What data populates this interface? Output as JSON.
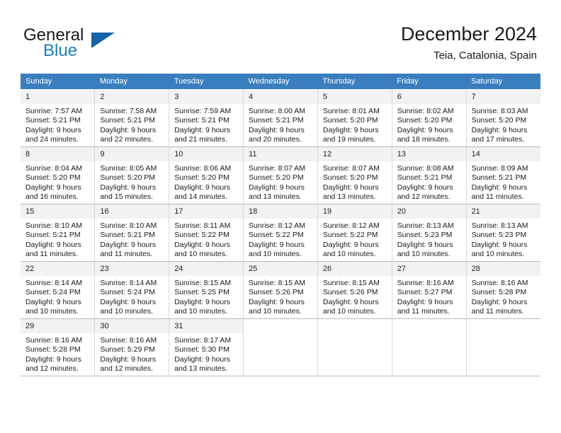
{
  "brand": {
    "word_general": "General",
    "word_blue": "Blue",
    "logo_icon": "triangle-flag-icon"
  },
  "header": {
    "title": "December 2024",
    "subtitle": "Teia, Catalonia, Spain"
  },
  "colors": {
    "header_row_bg": "#3a7ebf",
    "daynum_bg": "#f2f2f2",
    "brand_blue": "#1a7fc1",
    "grid_line": "#d9d9d9"
  },
  "weekdays": [
    "Sunday",
    "Monday",
    "Tuesday",
    "Wednesday",
    "Thursday",
    "Friday",
    "Saturday"
  ],
  "weeks": [
    [
      {
        "day": "1",
        "sunrise": "Sunrise: 7:57 AM",
        "sunset": "Sunset: 5:21 PM",
        "daylight1": "Daylight: 9 hours",
        "daylight2": "and 24 minutes."
      },
      {
        "day": "2",
        "sunrise": "Sunrise: 7:58 AM",
        "sunset": "Sunset: 5:21 PM",
        "daylight1": "Daylight: 9 hours",
        "daylight2": "and 22 minutes."
      },
      {
        "day": "3",
        "sunrise": "Sunrise: 7:59 AM",
        "sunset": "Sunset: 5:21 PM",
        "daylight1": "Daylight: 9 hours",
        "daylight2": "and 21 minutes."
      },
      {
        "day": "4",
        "sunrise": "Sunrise: 8:00 AM",
        "sunset": "Sunset: 5:21 PM",
        "daylight1": "Daylight: 9 hours",
        "daylight2": "and 20 minutes."
      },
      {
        "day": "5",
        "sunrise": "Sunrise: 8:01 AM",
        "sunset": "Sunset: 5:20 PM",
        "daylight1": "Daylight: 9 hours",
        "daylight2": "and 19 minutes."
      },
      {
        "day": "6",
        "sunrise": "Sunrise: 8:02 AM",
        "sunset": "Sunset: 5:20 PM",
        "daylight1": "Daylight: 9 hours",
        "daylight2": "and 18 minutes."
      },
      {
        "day": "7",
        "sunrise": "Sunrise: 8:03 AM",
        "sunset": "Sunset: 5:20 PM",
        "daylight1": "Daylight: 9 hours",
        "daylight2": "and 17 minutes."
      }
    ],
    [
      {
        "day": "8",
        "sunrise": "Sunrise: 8:04 AM",
        "sunset": "Sunset: 5:20 PM",
        "daylight1": "Daylight: 9 hours",
        "daylight2": "and 16 minutes."
      },
      {
        "day": "9",
        "sunrise": "Sunrise: 8:05 AM",
        "sunset": "Sunset: 5:20 PM",
        "daylight1": "Daylight: 9 hours",
        "daylight2": "and 15 minutes."
      },
      {
        "day": "10",
        "sunrise": "Sunrise: 8:06 AM",
        "sunset": "Sunset: 5:20 PM",
        "daylight1": "Daylight: 9 hours",
        "daylight2": "and 14 minutes."
      },
      {
        "day": "11",
        "sunrise": "Sunrise: 8:07 AM",
        "sunset": "Sunset: 5:20 PM",
        "daylight1": "Daylight: 9 hours",
        "daylight2": "and 13 minutes."
      },
      {
        "day": "12",
        "sunrise": "Sunrise: 8:07 AM",
        "sunset": "Sunset: 5:20 PM",
        "daylight1": "Daylight: 9 hours",
        "daylight2": "and 13 minutes."
      },
      {
        "day": "13",
        "sunrise": "Sunrise: 8:08 AM",
        "sunset": "Sunset: 5:21 PM",
        "daylight1": "Daylight: 9 hours",
        "daylight2": "and 12 minutes."
      },
      {
        "day": "14",
        "sunrise": "Sunrise: 8:09 AM",
        "sunset": "Sunset: 5:21 PM",
        "daylight1": "Daylight: 9 hours",
        "daylight2": "and 11 minutes."
      }
    ],
    [
      {
        "day": "15",
        "sunrise": "Sunrise: 8:10 AM",
        "sunset": "Sunset: 5:21 PM",
        "daylight1": "Daylight: 9 hours",
        "daylight2": "and 11 minutes."
      },
      {
        "day": "16",
        "sunrise": "Sunrise: 8:10 AM",
        "sunset": "Sunset: 5:21 PM",
        "daylight1": "Daylight: 9 hours",
        "daylight2": "and 11 minutes."
      },
      {
        "day": "17",
        "sunrise": "Sunrise: 8:11 AM",
        "sunset": "Sunset: 5:22 PM",
        "daylight1": "Daylight: 9 hours",
        "daylight2": "and 10 minutes."
      },
      {
        "day": "18",
        "sunrise": "Sunrise: 8:12 AM",
        "sunset": "Sunset: 5:22 PM",
        "daylight1": "Daylight: 9 hours",
        "daylight2": "and 10 minutes."
      },
      {
        "day": "19",
        "sunrise": "Sunrise: 8:12 AM",
        "sunset": "Sunset: 5:22 PM",
        "daylight1": "Daylight: 9 hours",
        "daylight2": "and 10 minutes."
      },
      {
        "day": "20",
        "sunrise": "Sunrise: 8:13 AM",
        "sunset": "Sunset: 5:23 PM",
        "daylight1": "Daylight: 9 hours",
        "daylight2": "and 10 minutes."
      },
      {
        "day": "21",
        "sunrise": "Sunrise: 8:13 AM",
        "sunset": "Sunset: 5:23 PM",
        "daylight1": "Daylight: 9 hours",
        "daylight2": "and 10 minutes."
      }
    ],
    [
      {
        "day": "22",
        "sunrise": "Sunrise: 8:14 AM",
        "sunset": "Sunset: 5:24 PM",
        "daylight1": "Daylight: 9 hours",
        "daylight2": "and 10 minutes."
      },
      {
        "day": "23",
        "sunrise": "Sunrise: 8:14 AM",
        "sunset": "Sunset: 5:24 PM",
        "daylight1": "Daylight: 9 hours",
        "daylight2": "and 10 minutes."
      },
      {
        "day": "24",
        "sunrise": "Sunrise: 8:15 AM",
        "sunset": "Sunset: 5:25 PM",
        "daylight1": "Daylight: 9 hours",
        "daylight2": "and 10 minutes."
      },
      {
        "day": "25",
        "sunrise": "Sunrise: 8:15 AM",
        "sunset": "Sunset: 5:26 PM",
        "daylight1": "Daylight: 9 hours",
        "daylight2": "and 10 minutes."
      },
      {
        "day": "26",
        "sunrise": "Sunrise: 8:15 AM",
        "sunset": "Sunset: 5:26 PM",
        "daylight1": "Daylight: 9 hours",
        "daylight2": "and 10 minutes."
      },
      {
        "day": "27",
        "sunrise": "Sunrise: 8:16 AM",
        "sunset": "Sunset: 5:27 PM",
        "daylight1": "Daylight: 9 hours",
        "daylight2": "and 11 minutes."
      },
      {
        "day": "28",
        "sunrise": "Sunrise: 8:16 AM",
        "sunset": "Sunset: 5:28 PM",
        "daylight1": "Daylight: 9 hours",
        "daylight2": "and 11 minutes."
      }
    ],
    [
      {
        "day": "29",
        "sunrise": "Sunrise: 8:16 AM",
        "sunset": "Sunset: 5:28 PM",
        "daylight1": "Daylight: 9 hours",
        "daylight2": "and 12 minutes."
      },
      {
        "day": "30",
        "sunrise": "Sunrise: 8:16 AM",
        "sunset": "Sunset: 5:29 PM",
        "daylight1": "Daylight: 9 hours",
        "daylight2": "and 12 minutes."
      },
      {
        "day": "31",
        "sunrise": "Sunrise: 8:17 AM",
        "sunset": "Sunset: 5:30 PM",
        "daylight1": "Daylight: 9 hours",
        "daylight2": "and 13 minutes."
      },
      {
        "day": "",
        "sunrise": "",
        "sunset": "",
        "daylight1": "",
        "daylight2": ""
      },
      {
        "day": "",
        "sunrise": "",
        "sunset": "",
        "daylight1": "",
        "daylight2": ""
      },
      {
        "day": "",
        "sunrise": "",
        "sunset": "",
        "daylight1": "",
        "daylight2": ""
      },
      {
        "day": "",
        "sunrise": "",
        "sunset": "",
        "daylight1": "",
        "daylight2": ""
      }
    ]
  ]
}
